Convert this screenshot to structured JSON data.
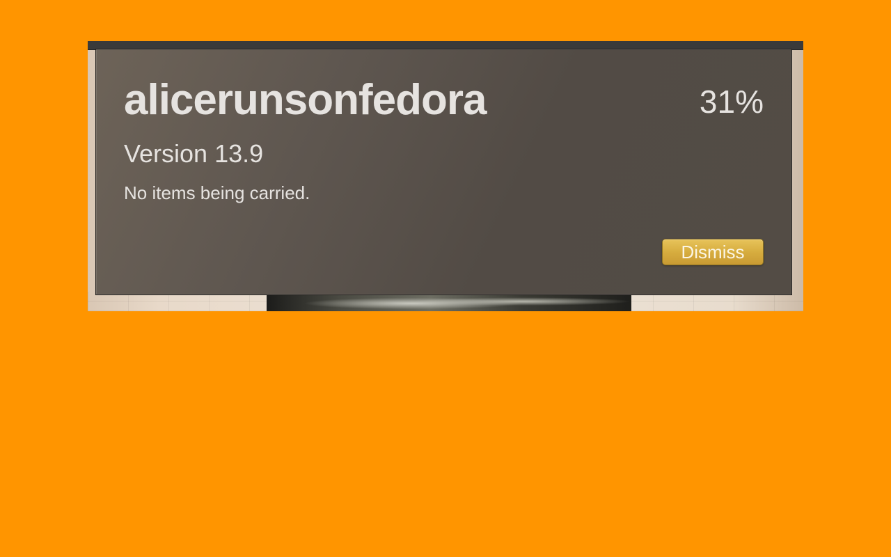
{
  "hud": {
    "title": "alicerunsonfedora",
    "percent": "31%",
    "version": "Version 13.9",
    "status": "No items being carried.",
    "dismiss_label": "Dismiss"
  },
  "colors": {
    "background": "#ff9500",
    "panel": "#5a534c",
    "text": "#e6e3e0",
    "button": "#d7ad3f"
  }
}
